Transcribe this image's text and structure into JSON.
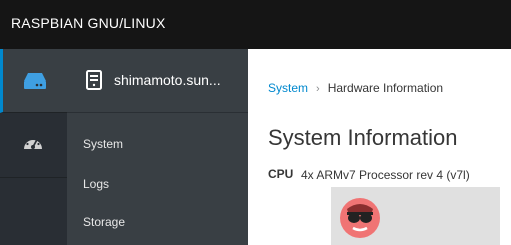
{
  "topbar": {
    "brand": "RASPBIAN GNU/LINUX"
  },
  "sidebar": {
    "host": {
      "name": "shimamoto.sun..."
    },
    "items": [
      {
        "label": "System"
      },
      {
        "label": "Logs"
      },
      {
        "label": "Storage"
      }
    ]
  },
  "breadcrumb": {
    "root": "System",
    "separator": "›",
    "current": "Hardware Information"
  },
  "main": {
    "title": "System Information",
    "cpu": {
      "label": "CPU",
      "value": "4x ARMv7 Processor rev 4 (v7l)"
    }
  },
  "icons": {
    "host": "server-icon",
    "dashboard": "dashboard-gauge-icon",
    "machine": "document-server-icon",
    "avatar": "sunglasses-avatar-icon"
  },
  "colors": {
    "accent": "#0088ce",
    "topbar": "#151515",
    "rail": "#292e34",
    "sidenav": "#393f44"
  }
}
